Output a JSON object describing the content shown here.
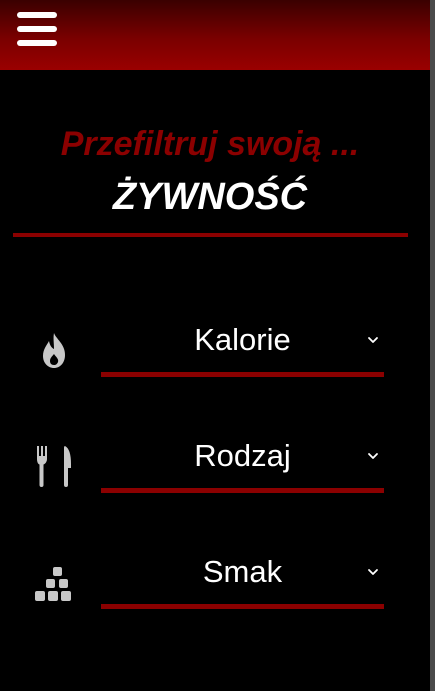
{
  "header": {
    "menu_icon": "hamburger-menu-icon"
  },
  "heading": {
    "subtitle": "Przefiltruj swoją ...",
    "title": "ŻYWNOŚĆ"
  },
  "filters": [
    {
      "icon": "fire-icon",
      "label": "Kalorie"
    },
    {
      "icon": "utensils-icon",
      "label": "Rodzaj"
    },
    {
      "icon": "sugar-cubes-icon",
      "label": "Smak"
    }
  ],
  "colors": {
    "accent": "#8b0000",
    "header_top": "#3a0000",
    "header_bottom": "#9a0000",
    "icon": "#c8c8c8",
    "background": "#000000"
  }
}
